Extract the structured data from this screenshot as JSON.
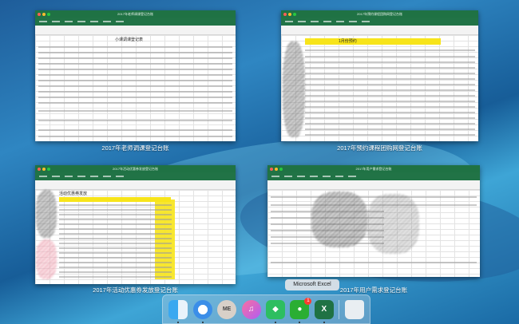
{
  "windows": [
    {
      "id": "w1",
      "title": "2017年老师调课登记台账",
      "sheet_heading": "小课调课登记表",
      "caption": "2017年老师调课登记台账"
    },
    {
      "id": "w2",
      "title": "2017年预约课程团购网登记台账",
      "sheet_heading": "1月份预约",
      "caption": "2017年预约课程团购网登记台账"
    },
    {
      "id": "w3",
      "title": "2017年活动优惠券发放登记台账",
      "sheet_heading": "活动优惠券发放",
      "caption": "2017年活动优惠券发放登记台账"
    },
    {
      "id": "w4",
      "title": "2017年用户需求登记台账",
      "sheet_heading": "",
      "caption": "2017年用户需求登记台账"
    }
  ],
  "tooltip": "Microsoft Excel",
  "dock": {
    "items": [
      {
        "name": "Finder",
        "icon": "finder-icon"
      },
      {
        "name": "Safari",
        "icon": "safari-icon"
      },
      {
        "name": "ME",
        "icon": "me-icon",
        "label": "ME"
      },
      {
        "name": "iTunes",
        "icon": "itunes-icon"
      },
      {
        "name": "Evernote",
        "icon": "evernote-icon"
      },
      {
        "name": "WeChat",
        "icon": "wechat-icon",
        "badge": "1"
      },
      {
        "name": "Microsoft Excel",
        "icon": "excel-icon",
        "label": "X"
      },
      {
        "name": "Trash",
        "icon": "trash-icon"
      }
    ]
  },
  "colors": {
    "excel_green": "#217346",
    "highlight_yellow": "#f7e41a",
    "desktop_blue": "#1e5d9a"
  }
}
